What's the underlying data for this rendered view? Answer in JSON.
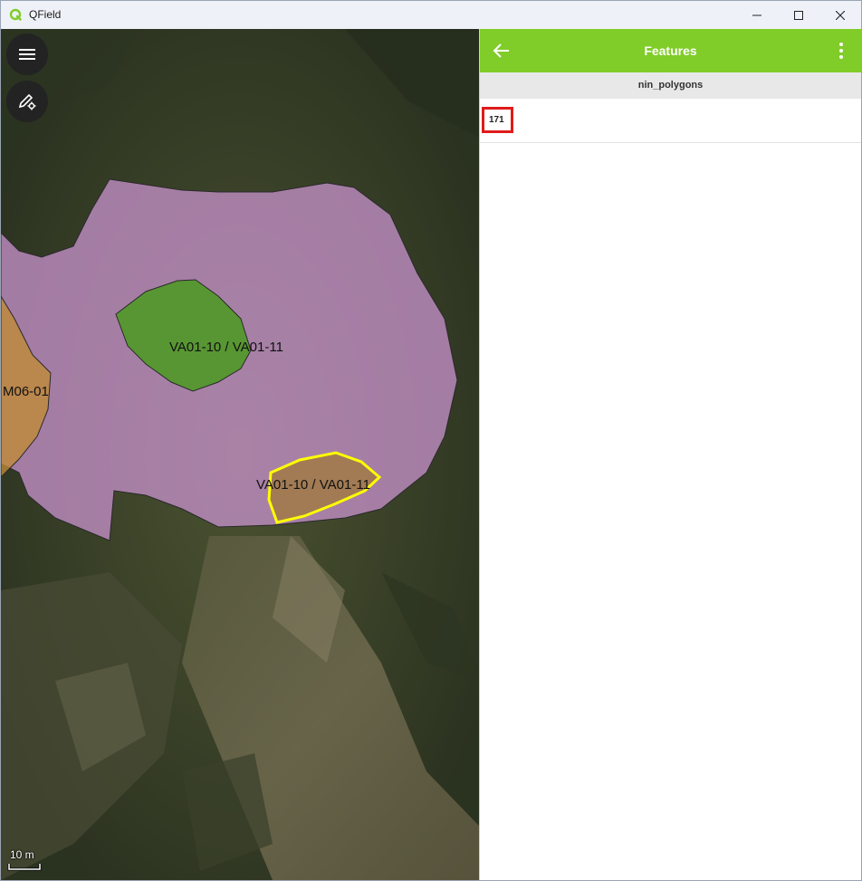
{
  "window": {
    "title": "QField"
  },
  "map": {
    "labels": {
      "green_polygon": "VA01-10 / VA01-11",
      "selected_polygon": "VA01-10 / VA01-11",
      "left_polygon": "M06-01"
    },
    "scale_label": "10 m",
    "selection_color": "#ffff00",
    "polygon_colors": {
      "large": "#c490c8",
      "green": "#4a9a1e",
      "orange": "#c08a35"
    }
  },
  "panel": {
    "title": "Features",
    "layer_name": "nin_polygons",
    "features": [
      {
        "id": "171"
      }
    ],
    "header_color": "#80cc28"
  }
}
